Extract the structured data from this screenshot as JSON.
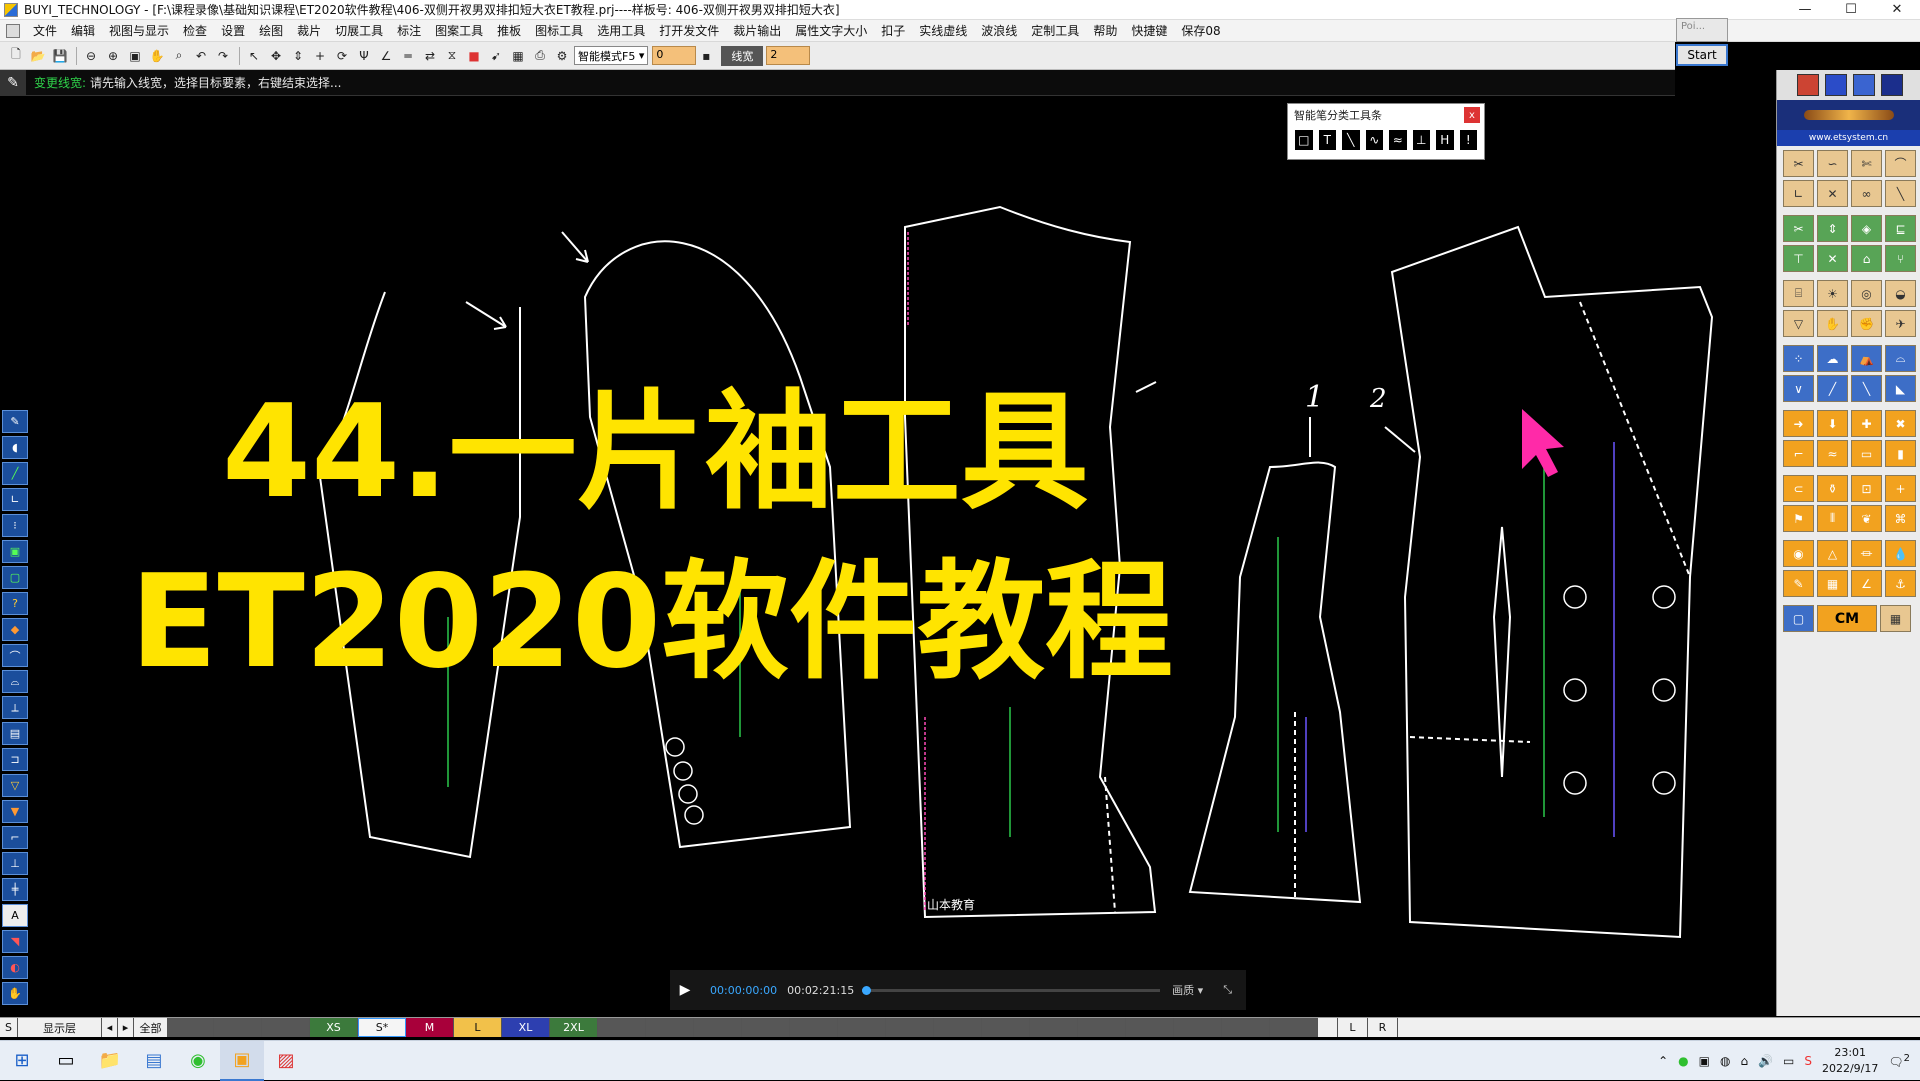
{
  "window": {
    "title": "BUYI_TECHNOLOGY - [F:\\课程录像\\基础知识课程\\ET2020软件教程\\406-双侧开衩男双排扣短大衣ET教程.prj----样板号: 406-双侧开衩男双排扣短大衣]",
    "controls": {
      "minimize": "—",
      "maximize": "☐",
      "close": "✕"
    }
  },
  "menu": [
    "文件",
    "编辑",
    "视图与显示",
    "检查",
    "设置",
    "绘图",
    "裁片",
    "切展工具",
    "标注",
    "图案工具",
    "推板",
    "图标工具",
    "选用工具",
    "打开发文件",
    "裁片输出",
    "属性文字大小",
    "扣子",
    "实线虚线",
    "波浪线",
    "定制工具",
    "帮助",
    "快捷键",
    "保存08"
  ],
  "toolbar": {
    "icons": [
      "new-file-icon",
      "open-file-icon",
      "save-icon",
      "zoom-out-icon",
      "zoom-in-icon",
      "fit-icon",
      "hand-icon",
      "zoom-area-icon",
      "undo-icon",
      "redo-icon",
      "select-icon",
      "move-icon",
      "dimension-icon",
      "cross-icon",
      "rotate-icon",
      "node-icon",
      "angle-icon",
      "line-icon",
      "flip-icon",
      "mirror-icon",
      "color-icon",
      "arrow-icon",
      "grid-icon",
      "print-icon",
      "settings-icon"
    ],
    "mode_select": "智能模式F5",
    "field_value": "0",
    "line_label": "线宽",
    "line_value": "2"
  },
  "poi_popup": "Poi...",
  "start_button": "Start",
  "prompt": {
    "command": "变更线宽:",
    "message": "请先输入线宽，选择目标要素，右键结束选择..."
  },
  "smart_toolbar": {
    "title": "智能笔分类工具条",
    "close": "x",
    "buttons": [
      "□",
      "T",
      "╲",
      "∿",
      "≈",
      "⊥",
      "H",
      "!"
    ]
  },
  "overlay": {
    "line1": "44.一片袖工具",
    "line2": "ET2020软件教程"
  },
  "canvas": {
    "numbers": [
      "1",
      "2"
    ],
    "watermark": "山本教育"
  },
  "player": {
    "current": "00:00:00:00",
    "duration": "00:02:21:15",
    "quality": "画质 ▾",
    "fullscreen": "⤡"
  },
  "size_bar": {
    "left_label": "S",
    "layer_label": "显示层",
    "all_label": "全部",
    "sizes": [
      {
        "label": "XS",
        "color": "#3c7a3c"
      },
      {
        "label": "S*",
        "color": "#f5f5f5"
      },
      {
        "label": "M",
        "color": "#a8003a"
      },
      {
        "label": "L",
        "color": "#f2c14a"
      },
      {
        "label": "XL",
        "color": "#2d3fb0"
      },
      {
        "label": "2XL",
        "color": "#3c7a3c"
      }
    ],
    "right_labels": [
      "L",
      "R"
    ]
  },
  "right_panel": {
    "url": "www.etsystem.cn",
    "cm": "CM"
  },
  "taskbar": {
    "time": "23:01",
    "date": "2022/9/17",
    "notifications": "2"
  }
}
